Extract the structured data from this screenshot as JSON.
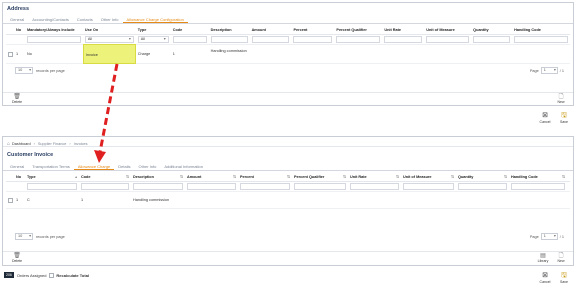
{
  "top_panel": {
    "title": "Address",
    "tabs": [
      "General",
      "Accounting/Contacts",
      "Contacts",
      "Other Info",
      "Allowance Charge Configuration"
    ],
    "active_tab": 4,
    "columns": [
      "No",
      "Mandatory/Always Include",
      "Use On",
      "Type",
      "Code",
      "Description",
      "Amount",
      "Percent",
      "Percent Qualifier",
      "Unit Rate",
      "Unit of Measure",
      "Quantity",
      "Handling Code"
    ],
    "filters": {
      "use_on": "All",
      "type": "All"
    },
    "row": {
      "no": "1",
      "mandatory": "No",
      "use_on": "Invoice",
      "type": "Charge",
      "code": "1",
      "description": "Handling commission"
    },
    "rows_per_page": "10",
    "rows_per_page_label": "records per page",
    "page_label": "Page",
    "page_value": "1",
    "page_total": "/ 1",
    "delete_label": "Delete",
    "new_label": "New"
  },
  "toolbar_top": {
    "cancel_label": "Cancel",
    "save_label": "Save"
  },
  "breadcrumb": [
    "Dashboard",
    "Supplier Finance",
    "Invoices"
  ],
  "bottom_panel": {
    "title": "Customer Invoice",
    "tabs": [
      "General",
      "Transportation Terms",
      "Allowance Charge",
      "Details",
      "Other Info",
      "Additional Information"
    ],
    "active_tab": 2,
    "columns": [
      "No",
      "Type",
      "Code",
      "Description",
      "Amount",
      "Percent",
      "Percent Qualifier",
      "Unit Rate",
      "Unit of Measure",
      "Quantity",
      "Handling Code"
    ],
    "row": {
      "no": "1",
      "type": "C",
      "code": "1",
      "description": "Handling commission"
    },
    "rows_per_page": "10",
    "rows_per_page_label": "records per page",
    "page_label": "Page",
    "page_value": "1",
    "page_total": "/ 1",
    "delete_label": "Delete",
    "library_label": "Library",
    "new_label": "New"
  },
  "orders": {
    "count": "206",
    "label": "Orders Assigned",
    "recalc_label": "Recalculate Total"
  },
  "toolbar_bottom": {
    "cancel_label": "Cancel",
    "save_label": "Save"
  },
  "colors": {
    "accent": "#e58a16",
    "highlight": "#ecf27a",
    "arrow": "#e02020",
    "title": "#2a3f62"
  }
}
